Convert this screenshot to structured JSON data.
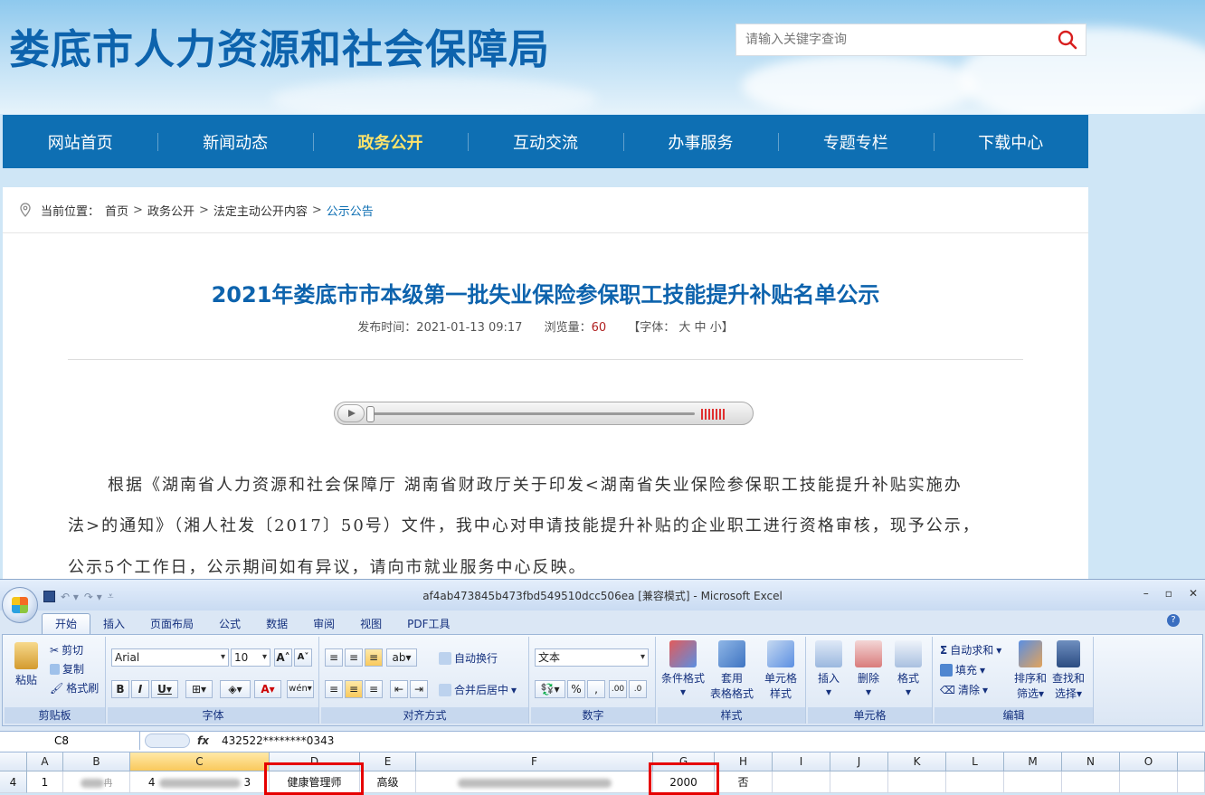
{
  "site": {
    "title": "娄底市人力资源和社会保障局",
    "search_placeholder": "请输入关键字查询"
  },
  "nav": [
    "网站首页",
    "新闻动态",
    "政务公开",
    "互动交流",
    "办事服务",
    "专题专栏",
    "下载中心"
  ],
  "breadcrumb": {
    "label": "当前位置：",
    "items": [
      "首页",
      "政务公开",
      "法定主动公开内容",
      "公示公告"
    ],
    "sep": ">"
  },
  "article": {
    "title": "2021年娄底市市本级第一批失业保险参保职工技能提升补贴名单公示",
    "publish_label": "发布时间：2021-01-13 09:17",
    "views_label": "浏览量：",
    "views": "60",
    "font_label": "【字体： 大 中 小】",
    "paragraph_lines": [
      "根据《湖南省人力资源和社会保障厅 湖南省财政厅关于印发<湖南省失业保险参保职工技能提升补贴实施办",
      "法>的通知》（湘人社发〔2017〕50号）文件，我中心对申请技能提升补贴的企业职工进行资格审核，现予公示，",
      "公示5个工作日，公示期间如有异议，请向市就业服务中心反映。"
    ]
  },
  "excel": {
    "window_title": "af4ab473845b473fbd549510dcc506ea  [兼容模式] - Microsoft Excel",
    "tabs": [
      "开始",
      "插入",
      "页面布局",
      "公式",
      "数据",
      "审阅",
      "视图",
      "PDF工具"
    ],
    "active_tab": "开始",
    "clipboard": {
      "paste": "粘贴",
      "cut": "剪切",
      "copy": "复制",
      "format_painter": "格式刷",
      "label": "剪贴板"
    },
    "font": {
      "name": "Arial",
      "size": "10",
      "label": "字体"
    },
    "alignment": {
      "wrap": "自动换行",
      "merge": "合并后居中",
      "label": "对齐方式"
    },
    "number": {
      "format": "文本",
      "label": "数字"
    },
    "styles": {
      "conditional": "条件格式",
      "table1": "套用",
      "table2": "表格格式",
      "cell1": "单元格",
      "cell2": "样式",
      "label": "样式"
    },
    "cells": {
      "insert": "插入",
      "delete": "删除",
      "format": "格式",
      "label": "单元格"
    },
    "editing": {
      "autosum": "自动求和",
      "fill": "填充",
      "clear": "清除",
      "sort1": "排序和",
      "sort2": "筛选",
      "find1": "查找和",
      "find2": "选择",
      "label": "编辑"
    },
    "name_box": "C8",
    "fx": "fx",
    "formula_value": "432522********0343",
    "columns": [
      "A",
      "B",
      "C",
      "D",
      "E",
      "F",
      "G",
      "H",
      "I",
      "J",
      "K",
      "L",
      "M",
      "N",
      "O"
    ],
    "row": {
      "number": "4",
      "A": "1",
      "B": "冉",
      "C_prefix": "4",
      "C_suffix": "3",
      "D": "健康管理师",
      "E": "高级",
      "G": "2000",
      "H": "否"
    }
  },
  "colors": {
    "brand_blue": "#0e6fb3",
    "nav_active": "#ffe36a",
    "highlight_red": "#e60000"
  }
}
